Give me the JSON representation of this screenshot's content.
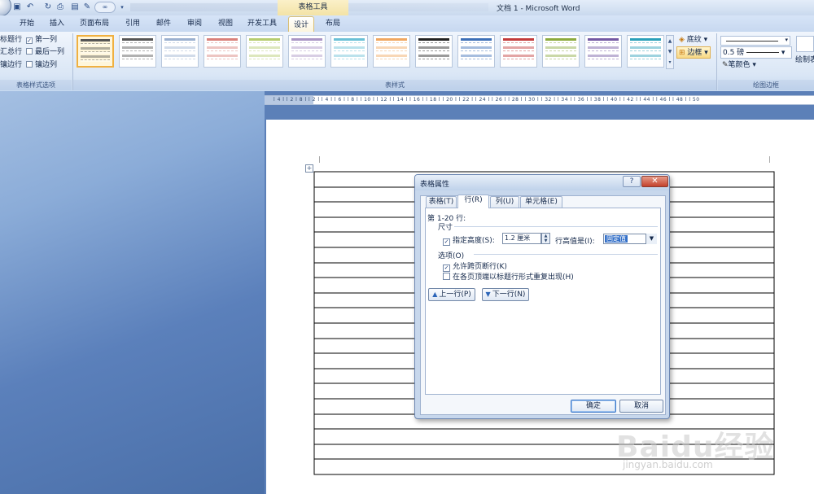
{
  "titlebar": {
    "context_header": "表格工具",
    "doc_title": "文档 1 - Microsoft Word",
    "qat_undo_icon": "undo-icon",
    "qat_inf": "∞"
  },
  "tabs": {
    "home": "开始",
    "insert": "插入",
    "page_layout": "页面布局",
    "references": "引用",
    "mailings": "邮件",
    "review": "审阅",
    "view": "视图",
    "developer": "开发工具",
    "design": "设计",
    "layout": "布局"
  },
  "ribbon": {
    "style_options": {
      "header_row": "标题行",
      "first_col": "第一列",
      "total_row": "汇总行",
      "last_col": "最后一列",
      "banded_rows": "镶边行",
      "banded_cols": "镶边列",
      "label": "表格样式选项"
    },
    "table_styles": {
      "label": "表样式"
    },
    "shading": "底纹",
    "borders": "边框",
    "pen_weight": "0.5 磅",
    "pen_color": "笔颜色",
    "draw_table": "绘制表",
    "draw_borders_label": "绘图边框",
    "style_colors": [
      "#555555",
      "#555555",
      "#9bb0cf",
      "#d9807a",
      "#b6cc6e",
      "#a995c4",
      "#6ac0d6",
      "#f0a760",
      "#222222",
      "#3c6fb7",
      "#c23a3a",
      "#8caa3d",
      "#7358a3",
      "#2aa0b9"
    ]
  },
  "ruler": {
    "marks": "l 4 l l 2 l 8 l l 2 l l 4 l l 6 l l 8 l l 10 l l 12 l l 14 l l 16 l l 18 l l 20 l l 22 l l 24 l l 26 l l 28 l l 30 l l 32 l l 34 l l 36 l l 38 l l 40 l l 42 l l 44 l l 46 l l 48 l l 50"
  },
  "table": {
    "rows": 20
  },
  "dialog": {
    "title": "表格属性",
    "help": "?",
    "close": "✕",
    "tabs": {
      "table": "表格(T)",
      "row": "行(R)",
      "column": "列(U)",
      "cell": "单元格(E)"
    },
    "rows_label": "第 1-20 行:",
    "size_label": "尺寸",
    "specify_height": "指定高度(S):",
    "height_value": "1.2 厘米",
    "row_height_is": "行高值是(I):",
    "row_height_rule": "固定值",
    "options_label": "选项(O)",
    "allow_break": "允许跨页断行(K)",
    "repeat_header": "在各页顶端以标题行形式重复出现(H)",
    "prev_row": "上一行(P)",
    "next_row": "下一行(N)",
    "ok": "确定",
    "cancel": "取消"
  },
  "watermark": {
    "logo": "Baidu经验",
    "url": "jingyan.baidu.com"
  }
}
